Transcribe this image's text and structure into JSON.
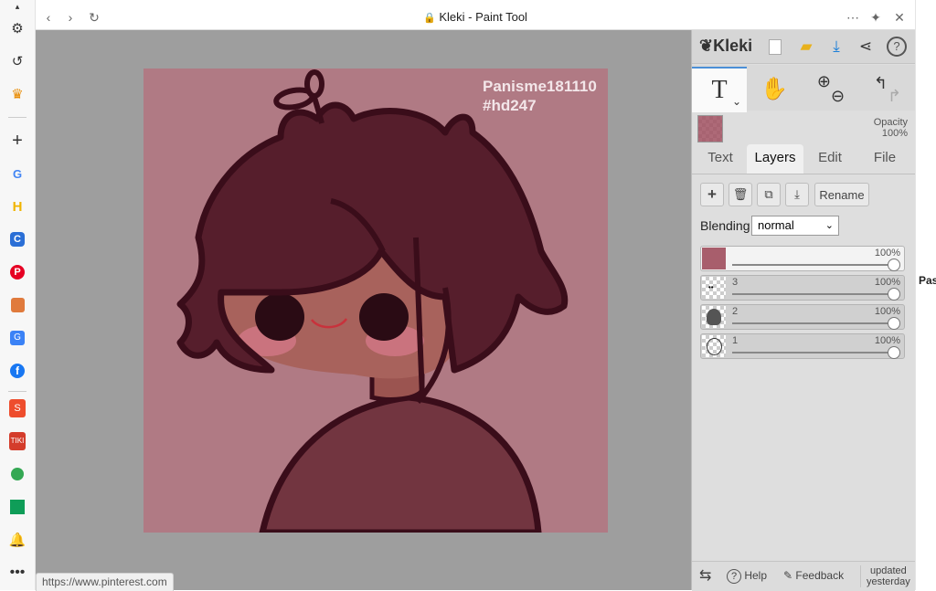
{
  "window": {
    "title": "Kleki - Paint Tool"
  },
  "canvas": {
    "watermark_line1": "Panisme181110",
    "watermark_line2": "#hd247"
  },
  "panel": {
    "brand": "Kleki",
    "opacity_label": "Opacity",
    "opacity_value": "100%",
    "tabs": [
      {
        "label": "Text"
      },
      {
        "label": "Layers"
      },
      {
        "label": "Edit"
      },
      {
        "label": "File"
      }
    ],
    "rename_label": "Rename",
    "blending_label": "Blending",
    "blending_value": "normal",
    "layers": [
      {
        "name": "",
        "opacity": "100%"
      },
      {
        "name": "3",
        "opacity": "100%"
      },
      {
        "name": "2",
        "opacity": "100%"
      },
      {
        "name": "1",
        "opacity": "100%"
      }
    ],
    "footer": {
      "help": "Help",
      "feedback": "Feedback",
      "updated_line1": "updated",
      "updated_line2": "yesterday"
    }
  },
  "status_url": "https://www.pinterest.com",
  "edge_text": "Pas",
  "colors": {
    "canvas_bg": "#b07a84",
    "hair": "#561e2c",
    "outline": "#3a0d1a",
    "skin": "#a8625c",
    "shirt": "#723540"
  }
}
